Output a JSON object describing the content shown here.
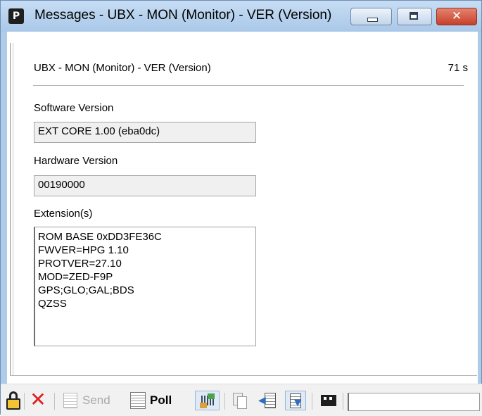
{
  "window": {
    "title": "Messages - UBX - MON (Monitor) - VER (Version)",
    "app_icon_letter": "P",
    "title_bar_color": "#aecbe9",
    "close_color": "#c7402b"
  },
  "message": {
    "header": "UBX - MON (Monitor) - VER (Version)",
    "age": "71 s"
  },
  "fields": {
    "software_version_label": "Software Version",
    "software_version_value": "EXT CORE 1.00 (eba0dc)",
    "hardware_version_label": "Hardware Version",
    "hardware_version_value": "00190000",
    "extensions_label": "Extension(s)",
    "extensions": [
      "ROM BASE 0xDD3FE36C",
      "FWVER=HPG 1.10",
      "PROTVER=27.10",
      "MOD=ZED-F9P",
      "GPS;GLO;GAL;BDS",
      "QZSS"
    ]
  },
  "toolbar": {
    "send_label": "Send",
    "poll_label": "Poll",
    "icons": [
      "lock-icon",
      "delete-icon",
      "send-icon",
      "poll-icon",
      "config-icon",
      "copy-icon",
      "import-icon",
      "export-icon",
      "record-icon"
    ],
    "status_text": ""
  }
}
